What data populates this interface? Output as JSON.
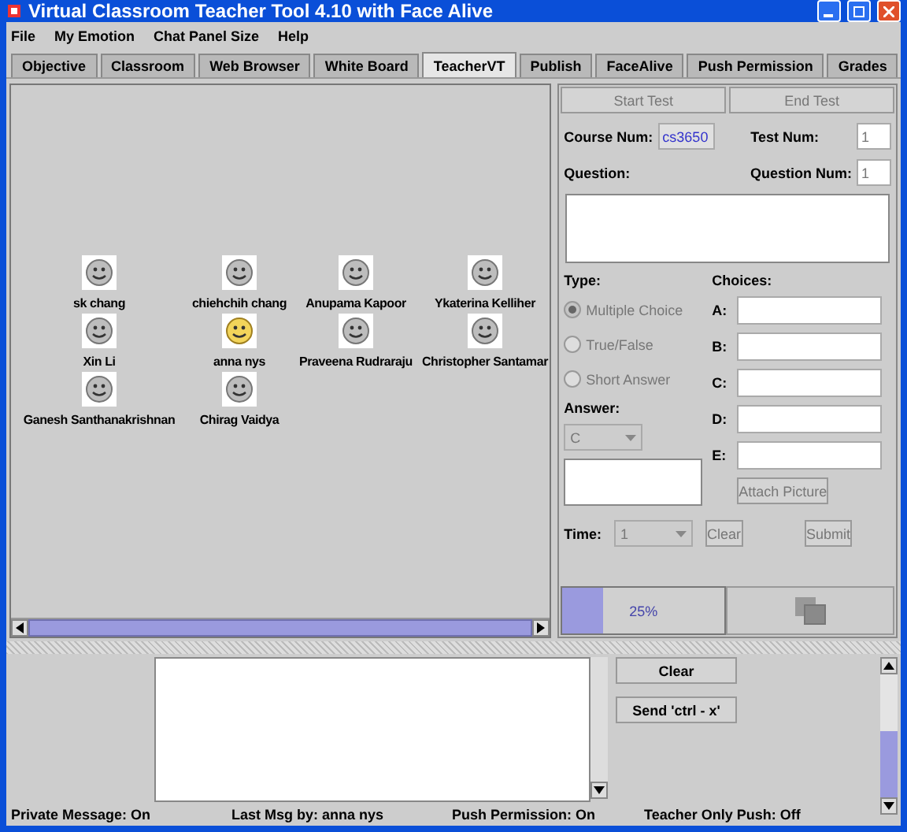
{
  "window": {
    "title": "Virtual Classroom Teacher Tool 4.10 with Face Alive"
  },
  "menu": [
    "File",
    "My Emotion",
    "Chat Panel Size",
    "Help"
  ],
  "tabs": [
    {
      "label": "Objective",
      "selected": false
    },
    {
      "label": "Classroom",
      "selected": false
    },
    {
      "label": "Web Browser",
      "selected": false
    },
    {
      "label": "White Board",
      "selected": false
    },
    {
      "label": "TeacherVT",
      "selected": true
    },
    {
      "label": "Publish",
      "selected": false
    },
    {
      "label": "FaceAlive",
      "selected": false
    },
    {
      "label": "Push Permission",
      "selected": false
    },
    {
      "label": "Grades",
      "selected": false
    }
  ],
  "students": [
    {
      "name": "sk chang",
      "active": false
    },
    {
      "name": "chiehchih chang",
      "active": false
    },
    {
      "name": "Anupama Kapoor",
      "active": false
    },
    {
      "name": "Ykaterina Kelliher",
      "active": false
    },
    {
      "name": "Xin Li",
      "active": false
    },
    {
      "name": "anna nys",
      "active": true
    },
    {
      "name": "Praveena Rudraraju",
      "active": false
    },
    {
      "name": "Christopher Santamar",
      "active": false
    },
    {
      "name": "Ganesh Santhanakrishnan",
      "active": false
    },
    {
      "name": "Chirag Vaidya",
      "active": false
    }
  ],
  "test_panel": {
    "start_button": {
      "label": "Start Test",
      "disabled": true
    },
    "end_button": {
      "label": "End Test",
      "disabled": true
    },
    "course_num": {
      "label": "Course Num:",
      "value": "cs3650"
    },
    "test_num": {
      "label": "Test Num:",
      "value": "1"
    },
    "question": {
      "label": "Question:"
    },
    "question_num": {
      "label": "Question Num:",
      "value": "1"
    },
    "type": {
      "label": "Type:",
      "options": [
        {
          "label": "Multiple Choice",
          "selected": true
        },
        {
          "label": "True/False",
          "selected": false
        },
        {
          "label": "Short Answer",
          "selected": false
        }
      ]
    },
    "choices": {
      "label": "Choices:",
      "items": [
        "A:",
        "B:",
        "C:",
        "D:",
        "E:"
      ]
    },
    "answer": {
      "label": "Answer:",
      "value": "C"
    },
    "attach_button": {
      "label": "Attach Picture",
      "disabled": true
    },
    "time": {
      "label": "Time:",
      "value": "1"
    },
    "clear_button": {
      "label": "Clear",
      "disabled": true
    },
    "submit_button": {
      "label": "Submit",
      "disabled": true
    },
    "progress": {
      "level": 0.25,
      "reading": "25%"
    }
  },
  "chat": {
    "clear_button": {
      "label": "Clear",
      "disabled": false
    },
    "send_button": {
      "label": "Send 'ctrl - x'",
      "disabled": false
    }
  },
  "status_bar": [
    "Private Message: On",
    "Last Msg by: anna nys",
    "Push Permission: On",
    "Teacher Only Push: Off"
  ]
}
